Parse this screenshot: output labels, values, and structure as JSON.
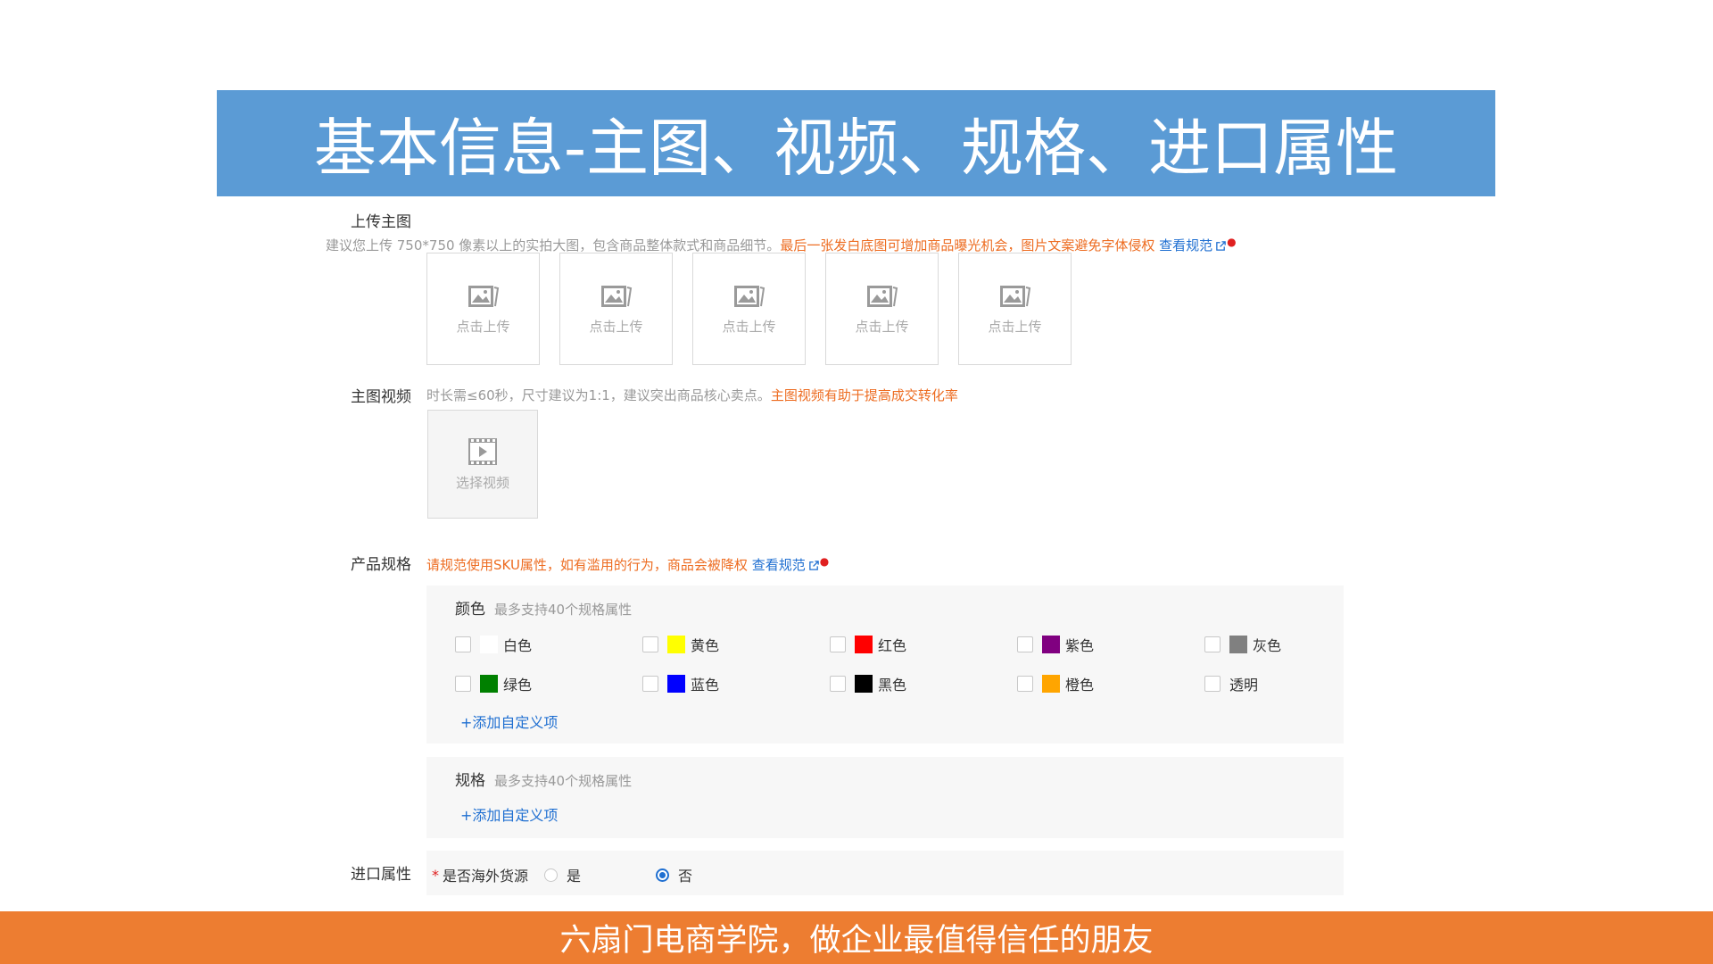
{
  "banner": {
    "title": "基本信息-主图、视频、规格、进口属性"
  },
  "main_image": {
    "label": "上传主图",
    "hint_gray": "建议您上传 750*750 像素以上的实拍大图，包含商品整体款式和商品细节。",
    "hint_orange": "最后一张发白底图可增加商品曝光机会，图片文案避免字体侵权",
    "link": "查看规范",
    "boxes": [
      "点击上传",
      "点击上传",
      "点击上传",
      "点击上传",
      "点击上传"
    ]
  },
  "video": {
    "label": "主图视频",
    "hint_gray": "时长需≤60秒，尺寸建议为1:1，建议突出商品核心卖点。",
    "hint_orange": "主图视频有助于提高成交转化率",
    "box_label": "选择视频"
  },
  "spec": {
    "label": "产品规格",
    "hint_orange": "请规范使用SKU属性，如有滥用的行为，商品会被降权",
    "link": "查看规范",
    "color_group": {
      "title": "颜色",
      "sub": "最多支持40个规格属性",
      "options": [
        {
          "label": "白色",
          "color": "#ffffff"
        },
        {
          "label": "黄色",
          "color": "#ffff00"
        },
        {
          "label": "红色",
          "color": "#ff0000"
        },
        {
          "label": "紫色",
          "color": "#800080"
        },
        {
          "label": "灰色",
          "color": "#808080"
        },
        {
          "label": "绿色",
          "color": "#008000"
        },
        {
          "label": "蓝色",
          "color": "#0000ff"
        },
        {
          "label": "黑色",
          "color": "#000000"
        },
        {
          "label": "橙色",
          "color": "#ffa500"
        },
        {
          "label": "透明",
          "color": ""
        }
      ],
      "add": "+添加自定义项"
    },
    "size_group": {
      "title": "规格",
      "sub": "最多支持40个规格属性",
      "add": "+添加自定义项"
    }
  },
  "import": {
    "label": "进口属性",
    "required_mark": "*",
    "question": "是否海外货源",
    "options": [
      "是",
      "否"
    ],
    "selected": "否"
  },
  "footer": {
    "text": "六扇门电商学院，做企业最值得信任的朋友"
  },
  "colors": {
    "banner": "#5b9bd5",
    "footer": "#ed7d31",
    "accent": "#1f6fd1",
    "warn": "#ed6c21"
  }
}
